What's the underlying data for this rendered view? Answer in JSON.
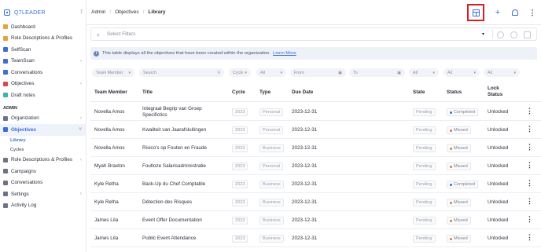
{
  "brand": {
    "name": "Q7LEADER",
    "pin": "⟟"
  },
  "sidebar": {
    "items": [
      {
        "label": "Dashboard",
        "color": "#e8a23b",
        "chevron": ""
      },
      {
        "label": "Role Descriptions & Profiles",
        "color": "#e8a23b",
        "chevron": ""
      },
      {
        "label": "SelfScan",
        "color": "#3b6fd6",
        "chevron": ""
      },
      {
        "label": "TeamScan",
        "color": "#3b6fd6",
        "chevron": "‹"
      },
      {
        "label": "Conversations",
        "color": "#3b6fd6",
        "chevron": ""
      },
      {
        "label": "Objectives",
        "color": "#d64a4a",
        "chevron": "‹"
      },
      {
        "label": "Draft notes",
        "color": "#3bb3a8",
        "chevron": ""
      }
    ],
    "admin_label": "ADMIN",
    "admin_items": [
      {
        "label": "Organization",
        "color": "#6d7380",
        "chevron": "‹",
        "active": false
      },
      {
        "label": "Objectives",
        "color": "#3b6fd6",
        "chevron": "˅",
        "active": true
      }
    ],
    "sub_items": [
      {
        "label": "Library",
        "active": true
      },
      {
        "label": "Cycles",
        "active": false
      }
    ],
    "admin_items_2": [
      {
        "label": "Role Descriptions & Profiles",
        "color": "#6d7380",
        "chevron": "‹"
      },
      {
        "label": "Campaigns",
        "color": "#6d7380",
        "chevron": ""
      },
      {
        "label": "Conversations",
        "color": "#6d7380",
        "chevron": ""
      },
      {
        "label": "Settings",
        "color": "#6d7380",
        "chevron": "‹"
      },
      {
        "label": "Activity Log",
        "color": "#6d7380",
        "chevron": ""
      }
    ]
  },
  "breadcrumb": [
    "Admin",
    "Objectives",
    "Library"
  ],
  "toolbar": {
    "add_label": "+",
    "menu_label": "⋮"
  },
  "filter": {
    "placeholder": "Select Filters",
    "caret": "▾"
  },
  "info": {
    "text": "This table displays all the objectives that have been created within the organization.",
    "link": "Learn More"
  },
  "controls": {
    "team_member": "Team Member",
    "search": "Search",
    "cycle": "Cycle",
    "type_all": "All",
    "from": "From",
    "to": "To",
    "state_all": "All",
    "status_all": "All",
    "lock_all": "All",
    "caret": "▾"
  },
  "table": {
    "headers": [
      "Team Member",
      "Title",
      "Cycle",
      "Type",
      "Due Date",
      "State",
      "Status",
      "Lock Status"
    ],
    "rows": [
      {
        "member": "Novella Amos",
        "title": "Integraal Begrip van Groep Specifictics",
        "cycle": "2023",
        "type": "Personal",
        "due": "2023-12-31",
        "state": "Pending",
        "status": "Completed",
        "status_color": "#3b6fd6",
        "lock": "Unlocked"
      },
      {
        "member": "Novella Amos",
        "title": "Kwaliteit van Jaarafsluitingen",
        "cycle": "2023",
        "type": "Personal",
        "due": "2023-12-31",
        "state": "Pending",
        "status": "Missed",
        "status_color": "#e8763b",
        "lock": "Unlocked"
      },
      {
        "member": "Novella Amos",
        "title": "Risico's op Fouten en Fraude",
        "cycle": "2023",
        "type": "Business",
        "due": "2023-12-31",
        "state": "Pending",
        "status": "Missed",
        "status_color": "#e8763b",
        "lock": "Unlocked"
      },
      {
        "member": "Myah Braxton",
        "title": "Foutloze Salarisadministratie",
        "cycle": "2023",
        "type": "Personal",
        "due": "2023-12-31",
        "state": "Pending",
        "status": "Missed",
        "status_color": "#e8763b",
        "lock": "Unlocked"
      },
      {
        "member": "Kyle Retha",
        "title": "Back-Up du Chef Comptable",
        "cycle": "2023",
        "type": "Business",
        "due": "2023-12-31",
        "state": "Pending",
        "status": "Completed",
        "status_color": "#3b6fd6",
        "lock": "Unlocked"
      },
      {
        "member": "Kyle Retha",
        "title": "Détection des Risques",
        "cycle": "2023",
        "type": "Business",
        "due": "2023-12-31",
        "state": "Pending",
        "status": "Missed",
        "status_color": "#e8763b",
        "lock": "Unlocked"
      },
      {
        "member": "James Lila",
        "title": "Event Offer Documentation",
        "cycle": "2023",
        "type": "Business",
        "due": "2023-12-31",
        "state": "Pending",
        "status": "Missed",
        "status_color": "#e8763b",
        "lock": "Unlocked"
      },
      {
        "member": "James Lila",
        "title": "Public Event Attendance",
        "cycle": "2023",
        "type": "Business",
        "due": "2023-12-31",
        "state": "Pending",
        "status": "Missed",
        "status_color": "#e8763b",
        "lock": "Unlocked"
      }
    ],
    "row_menu": "⋮"
  }
}
